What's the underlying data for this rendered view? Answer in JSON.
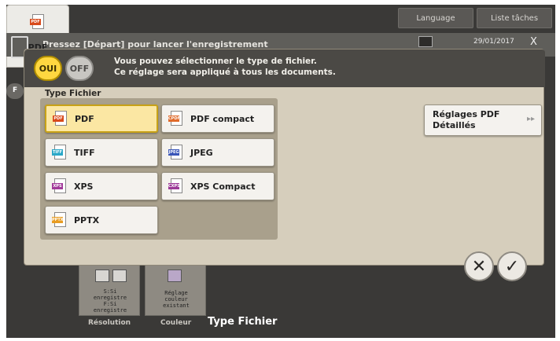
{
  "topbar": {
    "language_label": "Language",
    "list_label": "Liste tâches"
  },
  "background": {
    "message": "Pressez [Départ] pour lancer l'enregistrement",
    "date": "29/01/2017",
    "close_glyph": "X",
    "tab_label": "F"
  },
  "dialog": {
    "toggle_on": "OUI",
    "toggle_off": "OFF",
    "header_line1": "Vous pouvez sélectionner le type de fichier.",
    "header_line2": "Ce réglage sera appliqué à tous les documents.",
    "section_label": "Type Fichier",
    "options": [
      {
        "label": "PDF",
        "tag": "PDF",
        "color": "#d84a1b",
        "selected": true
      },
      {
        "label": "PDF compact",
        "tag": "CPDF",
        "color": "#e06a2a",
        "selected": false
      },
      {
        "label": "TIFF",
        "tag": "TIFF",
        "color": "#2aa8c8",
        "selected": false
      },
      {
        "label": "JPEG",
        "tag": "JPEG",
        "color": "#3a56b8",
        "selected": false
      },
      {
        "label": "XPS",
        "tag": "XPS",
        "color": "#a23a9a",
        "selected": false
      },
      {
        "label": "XPS Compact",
        "tag": "CXPS",
        "color": "#9c3a98",
        "selected": false
      },
      {
        "label": "PPTX",
        "tag": "PPTX",
        "color": "#e89c22",
        "selected": false
      }
    ],
    "detail_line1": "Réglages PDF",
    "detail_line2": "Détaillés",
    "detail_arrow": "▸▸"
  },
  "actions": {
    "cancel_glyph": "✕",
    "ok_glyph": "✓"
  },
  "function_tabs": {
    "resolution_lines": [
      "S:Si",
      "enregistre",
      "F:Si",
      "enregistre"
    ],
    "resolution_caption": "Résolution",
    "color_lines": [
      "Réglage",
      "couleur",
      "existant"
    ],
    "color_caption": "Couleur",
    "type_icon_tag": "PDF",
    "type_value": "PDF",
    "type_caption": "Type Fichier"
  }
}
